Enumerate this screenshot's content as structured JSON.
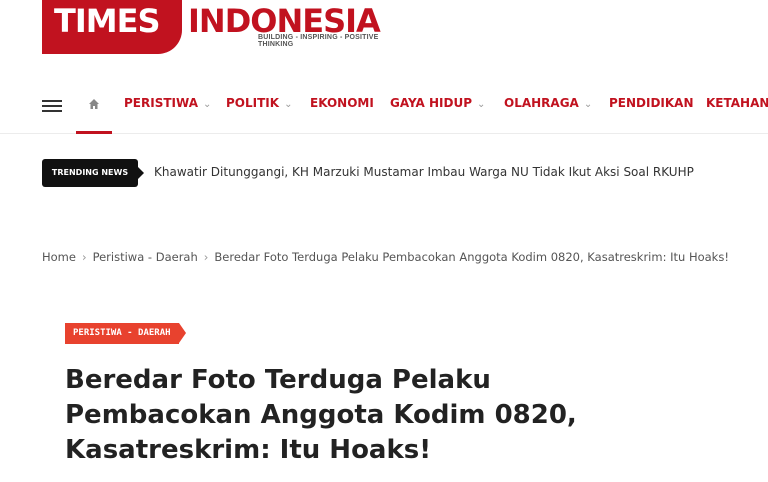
{
  "site": {
    "logo_left": "TIMES",
    "logo_right": "INDONESIA",
    "tagline": "BUILDING - INSPIRING - POSITIVE THINKING"
  },
  "nav": {
    "items": [
      {
        "label": "PERISTIWA",
        "dropdown": true
      },
      {
        "label": "POLITIK",
        "dropdown": true
      },
      {
        "label": "EKONOMI",
        "dropdown": false
      },
      {
        "label": "GAYA HIDUP",
        "dropdown": true
      },
      {
        "label": "OLAHRAGA",
        "dropdown": true
      },
      {
        "label": "PENDIDIKAN",
        "dropdown": false
      },
      {
        "label": "KETAHANA",
        "dropdown": false
      }
    ],
    "chevron": "⌄"
  },
  "trending": {
    "badge": "TRENDING NEWS",
    "headline": "Khawatir Ditunggangi, KH Marzuki Mustamar Imbau Warga NU Tidak Ikut Aksi Soal RKUHP"
  },
  "breadcrumb": {
    "items": [
      "Home",
      "Peristiwa - Daerah",
      "Beredar Foto Terduga Pelaku Pembacokan Anggota Kodim 0820, Kasatreskrim: Itu Hoaks!"
    ],
    "separator": "›"
  },
  "article": {
    "category": "PERISTIWA - DAERAH",
    "title": "Beredar Foto Terduga Pelaku Pembacokan Anggota Kodim 0820, Kasatreskrim: Itu Hoaks!"
  },
  "colors": {
    "brand_red": "#c1121f",
    "badge_red": "#e8422e",
    "trending_bg": "#111111"
  },
  "icons": {
    "menu": "hamburger-menu-icon",
    "home": "home-icon"
  }
}
